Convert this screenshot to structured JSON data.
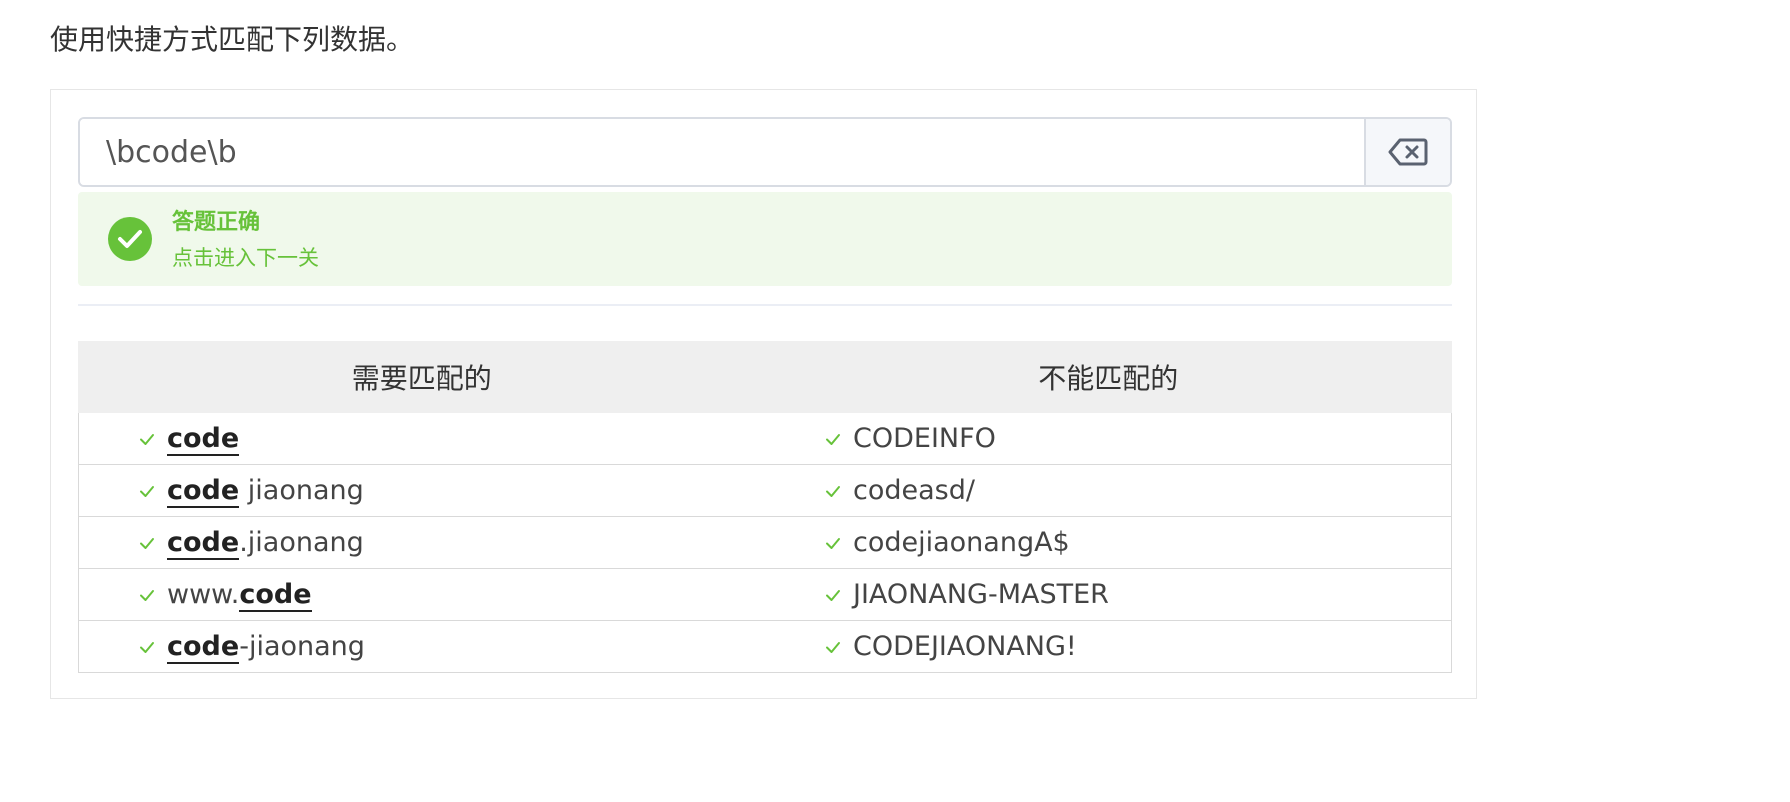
{
  "instruction": "使用快捷方式匹配下列数据。",
  "regex_input": {
    "value": "\\bcode\\b"
  },
  "clear_button": {
    "icon": "backspace-icon"
  },
  "result": {
    "icon": "check-circle-icon",
    "title": "答题正确",
    "subtitle": "点击进入下一关",
    "color": "#67c23a"
  },
  "table": {
    "headers": [
      "需要匹配的",
      "不能匹配的"
    ],
    "match_rows": [
      [
        {
          "text": "code",
          "highlight": true
        }
      ],
      [
        {
          "text": "code",
          "highlight": true
        },
        {
          "text": " jiaonang",
          "highlight": false
        }
      ],
      [
        {
          "text": "code",
          "highlight": true
        },
        {
          "text": ".jiaonang",
          "highlight": false
        }
      ],
      [
        {
          "text": "www.",
          "highlight": false
        },
        {
          "text": "code",
          "highlight": true
        }
      ],
      [
        {
          "text": "code",
          "highlight": true
        },
        {
          "text": "-jiaonang",
          "highlight": false
        }
      ]
    ],
    "nomatch_rows": [
      "CODEINFO",
      "codeasd/",
      "codejiaonangA$",
      "JIAONANG-MASTER",
      "CODEJIAONANG!"
    ],
    "row_status_icon": "check-icon",
    "check_color": "#67c23a"
  }
}
